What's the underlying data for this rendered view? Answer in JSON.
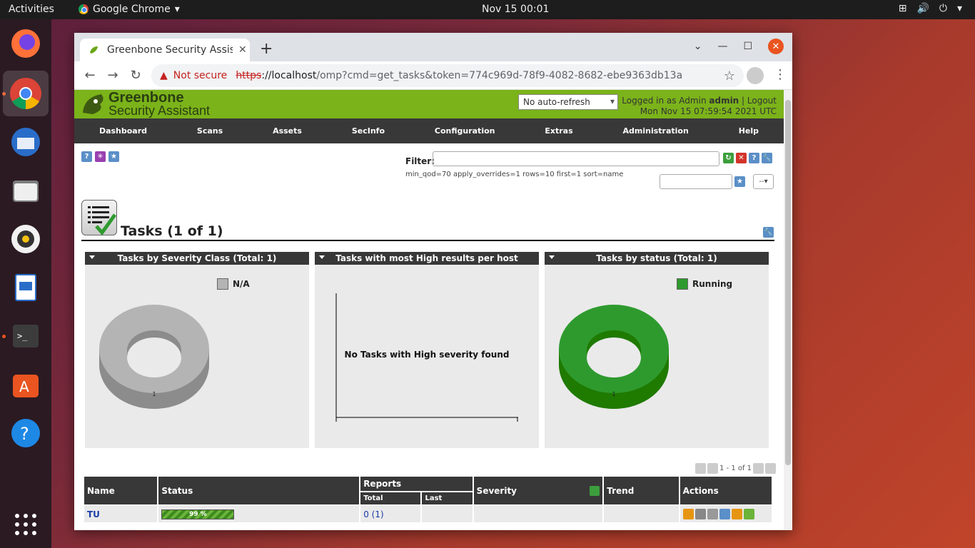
{
  "desktop": {
    "activities": "Activities",
    "app_name": "Google Chrome",
    "clock": "Nov 15  00:01"
  },
  "browser": {
    "tab_title": "Greenbone Security Assist",
    "not_secure": "Not secure",
    "url_scheme": "https",
    "url_host": "://localhost",
    "url_path": "/omp?cmd=get_tasks&token=774c969d-78f9-4082-8682-ebe9363db13a"
  },
  "gsa": {
    "logo_line1": "Greenbone",
    "logo_line2": "Security Assistant",
    "refresh_option": "No auto-refresh",
    "logged_in_prefix": "Logged in as  Admin ",
    "user": "admin",
    "logout": "Logout",
    "datetime": "Mon Nov 15 07:59:54 2021 UTC",
    "nav": [
      "Dashboard",
      "Scans",
      "Assets",
      "SecInfo",
      "Configuration",
      "Extras",
      "Administration",
      "Help"
    ],
    "filter_label": "Filter:",
    "filter_string": "min_qod=70 apply_overrides=1 rows=10 first=1 sort=name",
    "dropdown_small": "--",
    "page_title": "Tasks (1 of 1)"
  },
  "charts": {
    "severity": {
      "title": "Tasks by Severity Class (Total: 1)",
      "legend": "N/A",
      "label": "1"
    },
    "high_results": {
      "title": "Tasks with most High results per host",
      "message": "No Tasks with High severity found"
    },
    "status": {
      "title": "Tasks by status (Total: 1)",
      "legend": "Running",
      "label": "1"
    }
  },
  "chart_data": [
    {
      "type": "pie",
      "title": "Tasks by Severity Class (Total: 1)",
      "categories": [
        "N/A"
      ],
      "values": [
        1
      ]
    },
    {
      "type": "pie",
      "title": "Tasks by status (Total: 1)",
      "categories": [
        "Running"
      ],
      "values": [
        1
      ]
    }
  ],
  "pager": {
    "text": "1 - 1 of 1"
  },
  "table": {
    "headers": {
      "name": "Name",
      "status": "Status",
      "reports": "Reports",
      "total": "Total",
      "last": "Last",
      "severity": "Severity",
      "trend": "Trend",
      "actions": "Actions"
    },
    "rows": [
      {
        "name": "TU",
        "status": "99 %",
        "progress": 0.99,
        "total": "0 (1)",
        "last": "",
        "severity": "",
        "trend": ""
      }
    ]
  },
  "colors": {
    "gsa_green": "#7bb31a",
    "nav_dark": "#383838",
    "running": "#2e9a2e",
    "na_gray": "#b4b4b4"
  }
}
